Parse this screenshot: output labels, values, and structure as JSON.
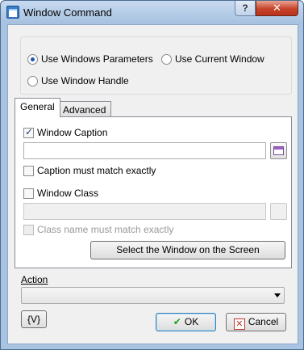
{
  "window": {
    "title": "Window Command",
    "help_label": "?",
    "close_label": "✕"
  },
  "mode": {
    "options": [
      {
        "label": "Use Windows Parameters",
        "selected": true
      },
      {
        "label": "Use Current Window",
        "selected": false
      },
      {
        "label": "Use Window Handle",
        "selected": false
      }
    ]
  },
  "tabs": [
    {
      "label": "General",
      "active": true
    },
    {
      "label": "Advanced",
      "active": false
    }
  ],
  "general": {
    "window_caption": {
      "label": "Window Caption",
      "checked": true,
      "value": ""
    },
    "caption_exact": {
      "label": "Caption must match exactly",
      "checked": false
    },
    "window_class": {
      "label": "Window Class",
      "checked": false,
      "value": ""
    },
    "class_exact": {
      "label": "Class name must match exactly",
      "checked": false,
      "enabled": false
    },
    "select_button": "Select the Window on the Screen"
  },
  "action": {
    "label": "Action",
    "value": ""
  },
  "footer": {
    "variables_button": "{V}",
    "ok_button": "OK",
    "cancel_button": "Cancel"
  },
  "icons": {
    "app": "window-command-icon",
    "picker": "window-picker-icon",
    "ok": "checkmark-icon",
    "cancel": "cancel-x-icon"
  }
}
